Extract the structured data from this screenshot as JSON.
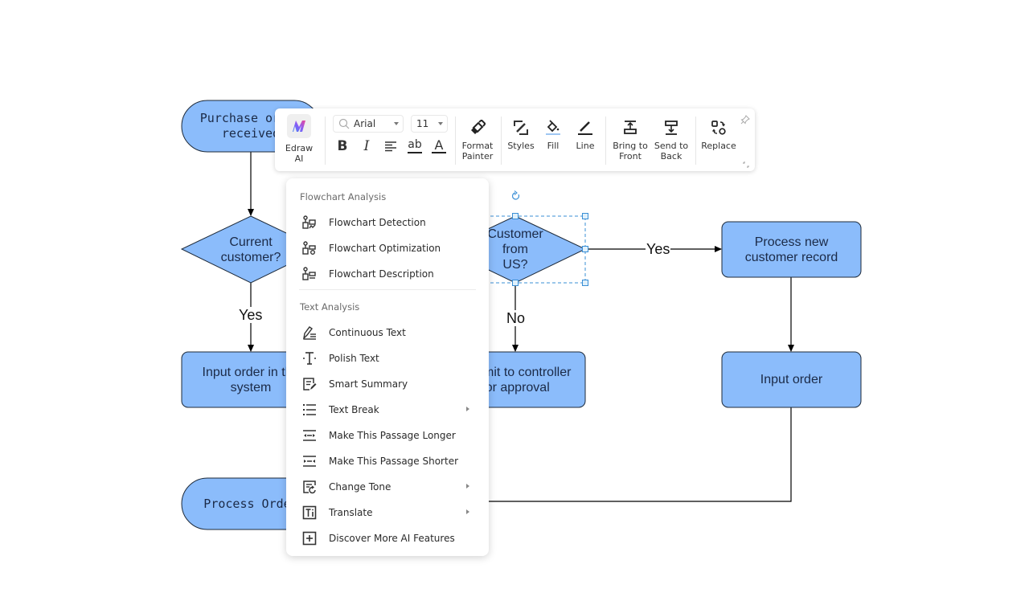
{
  "colors": {
    "shape_fill": "#8bbcfb",
    "shape_stroke": "#1d2a3a",
    "selection": "#3a8fd6",
    "menu_bg": "#ffffff"
  },
  "flowchart": {
    "shapes": {
      "purchase_order": "Purchase  order\nreceived",
      "current_customer": "Current\ncustomer?",
      "customer_from_us": "Customer\nfrom\nUS?",
      "process_new_customer": "Process new\ncustomer  record",
      "input_order_system": "Input order in the\nsystem",
      "submit_controller": "Submit to controller\nfor approval",
      "input_order": "Input order",
      "process_order": "Process Order"
    },
    "edge_labels": {
      "yes_left": "Yes",
      "yes_right": "Yes",
      "no": "No"
    }
  },
  "toolbar": {
    "edraw_ai": "Edraw AI",
    "font_name": "Arial",
    "font_size": "11",
    "bold": "B",
    "italic": "I",
    "underline": "ab",
    "font_color": "A",
    "format_painter": "Format\nPainter",
    "styles": "Styles",
    "fill": "Fill",
    "line": "Line",
    "bring_to_front": "Bring to\nFront",
    "send_to_back": "Send to\nBack",
    "replace": "Replace"
  },
  "ai_menu": {
    "sections": [
      {
        "title": "Flowchart Analysis",
        "items": [
          {
            "label": "Flowchart Detection",
            "icon": "flowchart-detection-icon",
            "submenu": false
          },
          {
            "label": "Flowchart Optimization",
            "icon": "flowchart-optimization-icon",
            "submenu": false
          },
          {
            "label": "Flowchart Description",
            "icon": "flowchart-description-icon",
            "submenu": false
          }
        ]
      },
      {
        "title": "Text Analysis",
        "items": [
          {
            "label": "Continuous Text",
            "icon": "continuous-text-icon",
            "submenu": false
          },
          {
            "label": "Polish Text",
            "icon": "polish-text-icon",
            "submenu": false
          },
          {
            "label": "Smart Summary",
            "icon": "smart-summary-icon",
            "submenu": false
          },
          {
            "label": "Text Break",
            "icon": "text-break-icon",
            "submenu": true
          },
          {
            "label": "Make This Passage Longer",
            "icon": "make-longer-icon",
            "submenu": false
          },
          {
            "label": "Make This Passage Shorter",
            "icon": "make-shorter-icon",
            "submenu": false
          },
          {
            "label": "Change Tone",
            "icon": "change-tone-icon",
            "submenu": true
          },
          {
            "label": "Translate",
            "icon": "translate-icon",
            "submenu": true
          },
          {
            "label": "Discover More AI Features",
            "icon": "discover-more-icon",
            "submenu": false
          }
        ]
      }
    ]
  }
}
